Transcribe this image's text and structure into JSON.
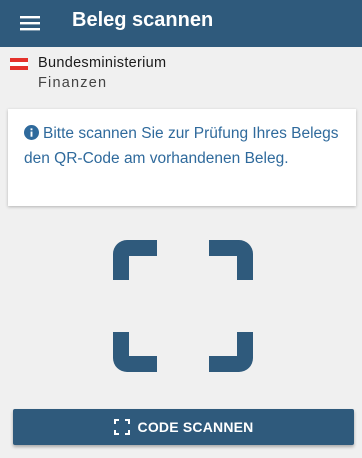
{
  "appbar": {
    "title": "Beleg scannen",
    "menu_icon": "hamburger-menu-icon",
    "background": "#2f5a7c"
  },
  "logo": {
    "line1": "Bundesministerium",
    "line2": "Finanzen",
    "flag_colors": [
      "#e4312b",
      "#ffffff",
      "#e4312b"
    ]
  },
  "info": {
    "icon": "info-icon",
    "message": "Bitte scannen Sie zur Prüfung Ihres Belegs den QR-Code am vorhandenen Beleg.",
    "text_color": "#2f6a9c"
  },
  "scanner": {
    "viewfinder_icon": "qr-viewfinder-icon"
  },
  "scan_button": {
    "label": "CODE SCANNEN",
    "icon": "scan-frame-icon"
  }
}
